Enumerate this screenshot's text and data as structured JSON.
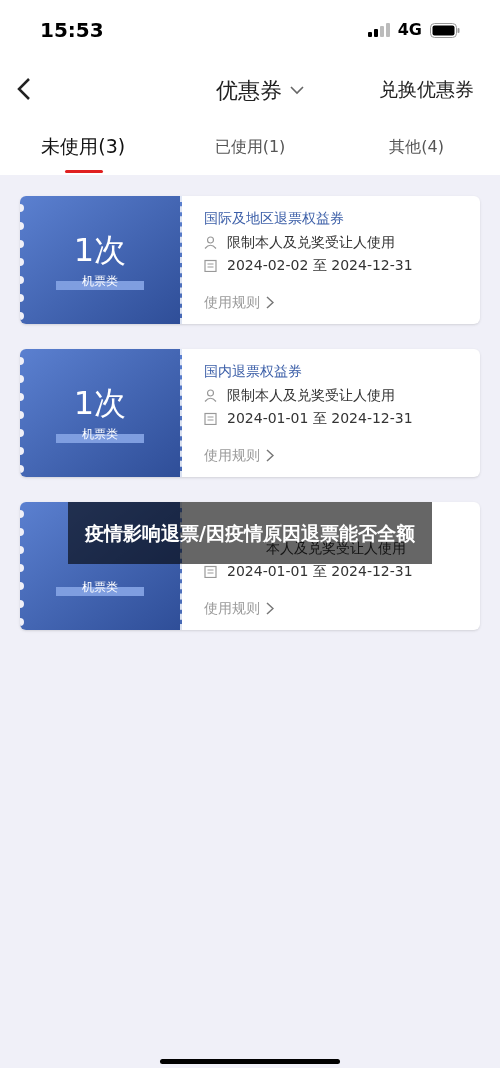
{
  "status_bar": {
    "time": "15:53",
    "network": "4G"
  },
  "nav": {
    "title": "优惠券",
    "action": "兑换优惠券"
  },
  "tabs": [
    {
      "label": "未使用(3)",
      "selected": true
    },
    {
      "label": "已使用(1)",
      "selected": false
    },
    {
      "label": "其他(4)",
      "selected": false
    }
  ],
  "coupons": [
    {
      "amount": "1次",
      "category": "机票类",
      "title": "国际及地区退票权益券",
      "restriction": "限制本人及兑奖受让人使用",
      "validity": "2024-02-02 至 2024-12-31",
      "rules": "使用规则"
    },
    {
      "amount": "1次",
      "category": "机票类",
      "title": "国内退票权益券",
      "restriction": "限制本人及兑奖受让人使用",
      "validity": "2024-01-01 至 2024-12-31",
      "rules": "使用规则"
    },
    {
      "category": "机票类",
      "restriction": "本人及兑奖受让人使用",
      "validity": "2024-01-01 至 2024-12-31",
      "rules": "使用规则"
    }
  ],
  "caption": "疫情影响退票/因疫情原因退票能否全额"
}
